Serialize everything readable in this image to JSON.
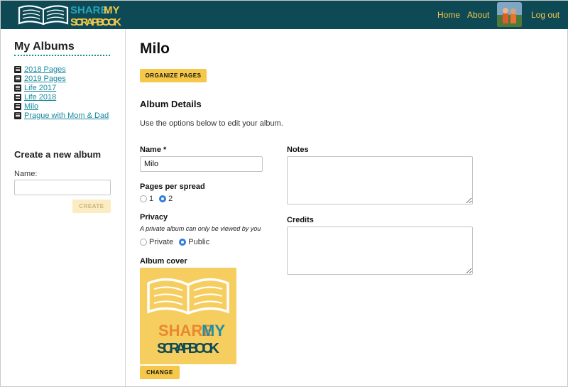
{
  "brand": {
    "name_part1": "SHARE",
    "name_part2": "MY",
    "name_part3": "SCRAPBOOK"
  },
  "nav": {
    "home": "Home",
    "about": "About",
    "logout": "Log out"
  },
  "sidebar": {
    "title": "My Albums",
    "albums": [
      {
        "label": "2018 Pages"
      },
      {
        "label": "2019 Pages"
      },
      {
        "label": "Life 2017"
      },
      {
        "label": "Life 2018"
      },
      {
        "label": "Milo"
      },
      {
        "label": "Prague with Mom & Dad"
      }
    ],
    "new_album": {
      "title": "Create a new album",
      "name_label": "Name:",
      "name_value": "",
      "create_label": "CREATE"
    }
  },
  "main": {
    "title": "Milo",
    "organize_label": "ORGANIZE PAGES",
    "details_title": "Album Details",
    "details_desc": "Use the options below to edit your album.",
    "name_label": "Name *",
    "name_value": "Milo",
    "pages_per_spread_label": "Pages per spread",
    "pages_per_spread_options": [
      {
        "label": "1",
        "selected": false
      },
      {
        "label": "2",
        "selected": true
      }
    ],
    "privacy_label": "Privacy",
    "privacy_help": "A private album can only be viewed by you",
    "privacy_options": [
      {
        "label": "Private",
        "selected": false
      },
      {
        "label": "Public",
        "selected": true
      }
    ],
    "cover_label": "Album cover",
    "change_label": "CHANGE",
    "notes_label": "Notes",
    "notes_value": "",
    "credits_label": "Credits",
    "credits_value": ""
  },
  "colors": {
    "header": "#0e4a55",
    "accent_yellow": "#f5c84a",
    "link_teal": "#1a8a9e",
    "radio_blue": "#2f7de1"
  }
}
